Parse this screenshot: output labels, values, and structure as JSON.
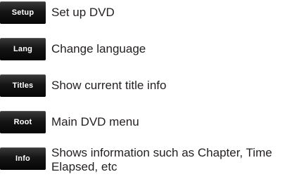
{
  "items": [
    {
      "button": "Setup",
      "description": "Set up DVD"
    },
    {
      "button": "Lang",
      "description": "Change language"
    },
    {
      "button": "Titles",
      "description": "Show current title info"
    },
    {
      "button": "Root",
      "description": "Main DVD menu"
    },
    {
      "button": "Info",
      "description": "Shows information such as Chapter, Time Elapsed, etc"
    }
  ]
}
